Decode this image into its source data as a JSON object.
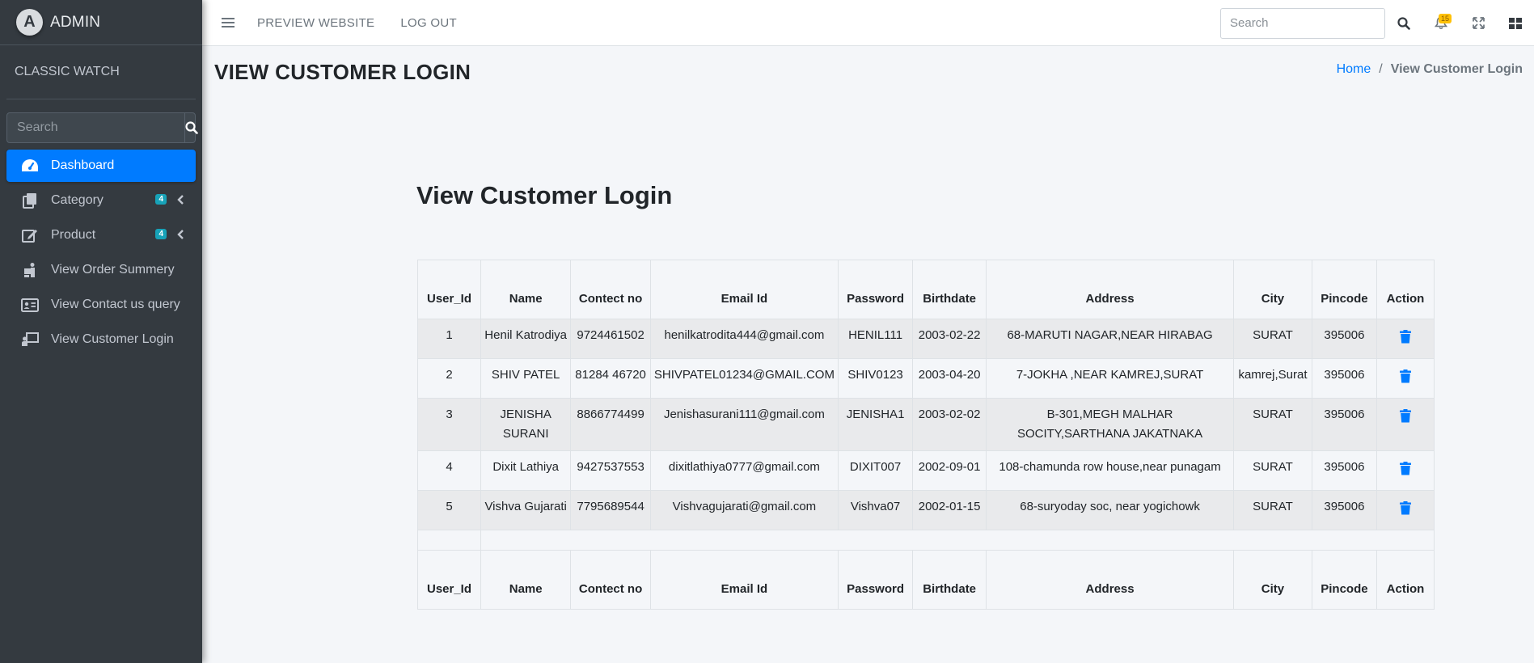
{
  "sidebar": {
    "brand": "ADMIN",
    "brand_logo_letter": "A",
    "user": "CLASSIC WATCH",
    "search_placeholder": "Search",
    "items": [
      {
        "label": "Dashboard",
        "icon": "tachometer-icon",
        "active": true
      },
      {
        "label": "Category",
        "icon": "copy-icon",
        "badge": "4"
      },
      {
        "label": "Product",
        "icon": "edit-icon",
        "badge": "4"
      },
      {
        "label": "View Order Summery",
        "icon": "people-carry-icon"
      },
      {
        "label": "View Contact us query",
        "icon": "id-card-icon"
      },
      {
        "label": "View Customer Login",
        "icon": "chalkboard-teacher-icon"
      }
    ]
  },
  "topbar": {
    "preview": "PREVIEW WEBSITE",
    "logout": "LOG OUT",
    "search_placeholder": "Search",
    "notification_count": "15"
  },
  "header": {
    "title": "VIEW CUSTOMER LOGIN",
    "breadcrumb_home": "Home",
    "breadcrumb_sep": "/",
    "breadcrumb_current": "View Customer Login"
  },
  "main": {
    "title": "View Customer Login",
    "columns": [
      "User_Id",
      "Name",
      "Contect no",
      "Email Id",
      "Password",
      "Birthdate",
      "Address",
      "City",
      "Pincode",
      "Action"
    ],
    "rows": [
      [
        "1",
        "Henil Katrodiya",
        "9724461502",
        "henilkatrodita444@gmail.com",
        "HENIL111",
        "2003-02-22",
        "68-MARUTI NAGAR,NEAR HIRABAG",
        "SURAT",
        "395006"
      ],
      [
        "2",
        "SHIV PATEL",
        "81284 46720",
        "SHIVPATEL01234@GMAIL.COM",
        "SHIV0123",
        "2003-04-20",
        "7-JOKHA ,NEAR KAMREJ,SURAT",
        "kamrej,Surat",
        "395006"
      ],
      [
        "3",
        "JENISHA SURANI",
        "8866774499",
        "Jenishasurani111@gmail.com",
        "JENISHA1",
        "2003-02-02",
        "B-301,MEGH MALHAR SOCITY,SARTHANA JAKATNAKA",
        "SURAT",
        "395006"
      ],
      [
        "4",
        "Dixit Lathiya",
        "9427537553",
        "dixitlathiya0777@gmail.com",
        "DIXIT007",
        "2002-09-01",
        "108-chamunda row house,near punagam",
        "SURAT",
        "395006"
      ],
      [
        "5",
        "Vishva Gujarati",
        "7795689544",
        "Vishvagujarati@gmail.com",
        "Vishva07",
        "2002-01-15",
        "68-suryoday soc, near yogichowk",
        "SURAT",
        "395006"
      ]
    ]
  }
}
